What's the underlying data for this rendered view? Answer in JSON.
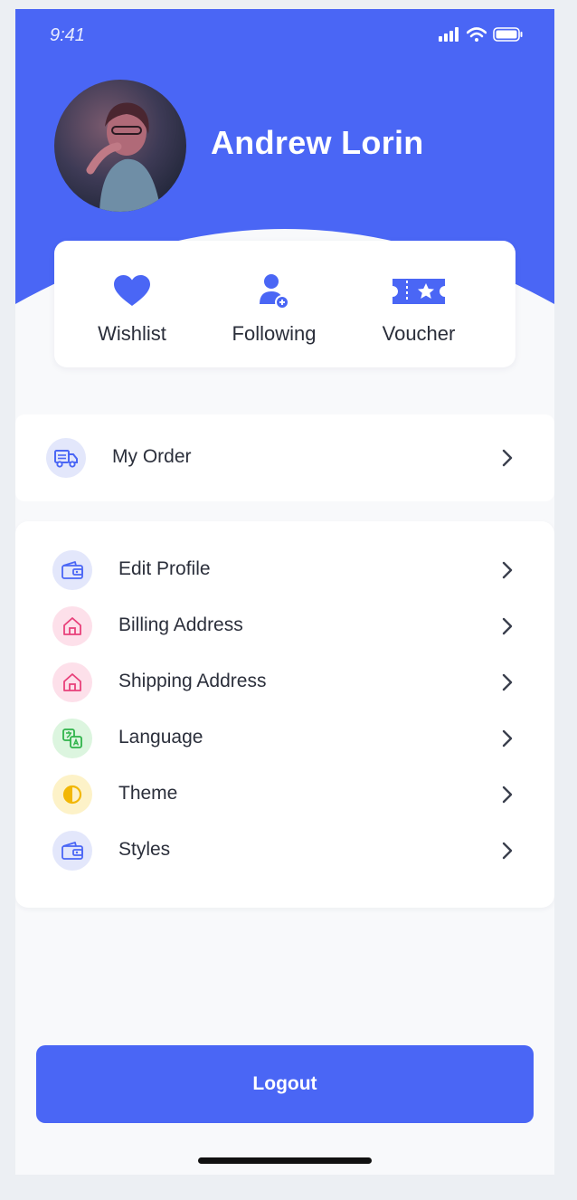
{
  "status_bar": {
    "time": "9:41"
  },
  "profile": {
    "name": "Andrew Lorin"
  },
  "quick_actions": [
    {
      "label": "Wishlist",
      "icon": "heart-icon"
    },
    {
      "label": "Following",
      "icon": "user-plus-icon"
    },
    {
      "label": "Voucher",
      "icon": "ticket-icon"
    }
  ],
  "order": {
    "label": "My Order",
    "icon": "truck-icon"
  },
  "menu": [
    {
      "label": "Edit Profile",
      "icon": "wallet-icon"
    },
    {
      "label": "Billing Address",
      "icon": "home-icon"
    },
    {
      "label": "Shipping Address",
      "icon": "home-icon"
    },
    {
      "label": "Language",
      "icon": "translate-icon"
    },
    {
      "label": "Theme",
      "icon": "half-circle-icon"
    },
    {
      "label": "Styles",
      "icon": "wallet-icon"
    }
  ],
  "logout": {
    "label": "Logout"
  },
  "colors": {
    "accent": "#4a66f5",
    "pink": "#e8407a",
    "green": "#2fb34a",
    "yellow": "#f2b705"
  }
}
